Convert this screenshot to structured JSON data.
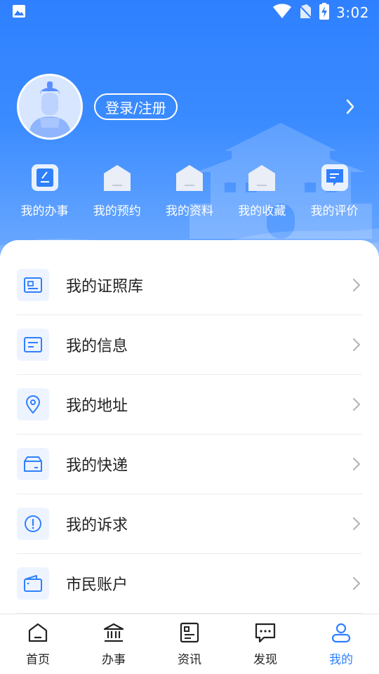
{
  "status_bar": {
    "time": "3:02",
    "icons": [
      "image-icon",
      "wifi-icon",
      "no-sim-icon",
      "battery-charging-icon"
    ]
  },
  "profile": {
    "avatar_icon": "user-avatar",
    "login_label": "登录/注册",
    "arrow_icon": "chevron-right-icon"
  },
  "quick_actions": [
    {
      "label": "我的办事",
      "icon": "edit-doc-icon"
    },
    {
      "label": "我的预约",
      "icon": "house-icon"
    },
    {
      "label": "我的资料",
      "icon": "house-icon"
    },
    {
      "label": "我的收藏",
      "icon": "house-icon"
    },
    {
      "label": "我的评价",
      "icon": "comment-icon"
    }
  ],
  "menu": [
    {
      "label": "我的证照库",
      "icon": "id-card-icon"
    },
    {
      "label": "我的信息",
      "icon": "info-card-icon"
    },
    {
      "label": "我的地址",
      "icon": "location-pin-icon"
    },
    {
      "label": "我的快递",
      "icon": "package-icon"
    },
    {
      "label": "我的诉求",
      "icon": "exclamation-circle-icon"
    },
    {
      "label": "市民账户",
      "icon": "wallet-icon"
    }
  ],
  "tabbar": [
    {
      "label": "首页",
      "icon": "home-icon",
      "active": false
    },
    {
      "label": "办事",
      "icon": "government-building-icon",
      "active": false
    },
    {
      "label": "资讯",
      "icon": "news-icon",
      "active": false
    },
    {
      "label": "发现",
      "icon": "chat-bubble-icon",
      "active": false
    },
    {
      "label": "我的",
      "icon": "person-icon",
      "active": true
    }
  ],
  "colors": {
    "primary": "#2f80ff",
    "header_top": "#2f80ff",
    "header_bottom": "#6fabff",
    "icon_bg": "#eef4ff",
    "text": "#222222"
  }
}
